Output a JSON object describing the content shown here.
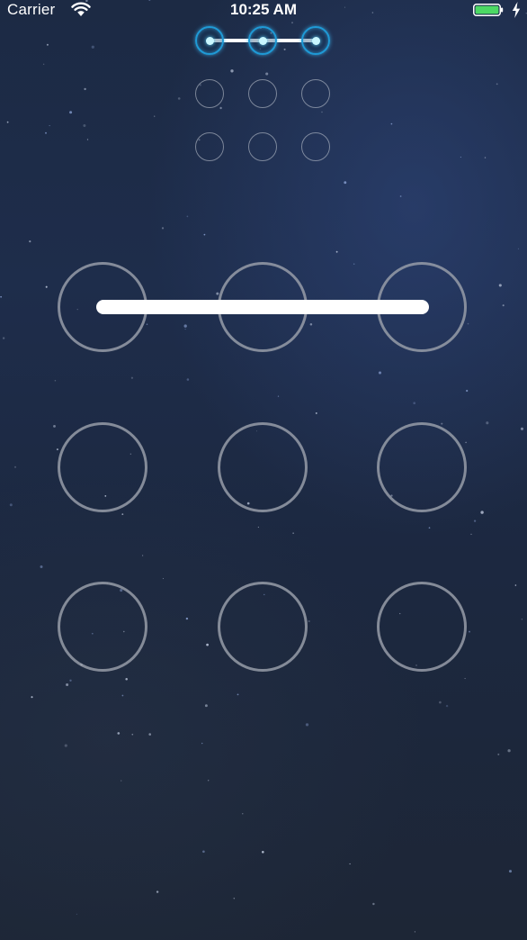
{
  "status_bar": {
    "carrier": "Carrier",
    "time": "10:25 AM",
    "battery_color": "#4cd964",
    "wifi_icon": "wifi-icon",
    "battery_icon": "battery-icon",
    "charging_icon": "bolt-icon"
  },
  "preview": {
    "active_dots": [
      0,
      1,
      2
    ],
    "accent_color": "#1f9ad6"
  },
  "pattern": {
    "selected_nodes": [
      0,
      1,
      2
    ],
    "stroke_color": "#ffffff"
  }
}
